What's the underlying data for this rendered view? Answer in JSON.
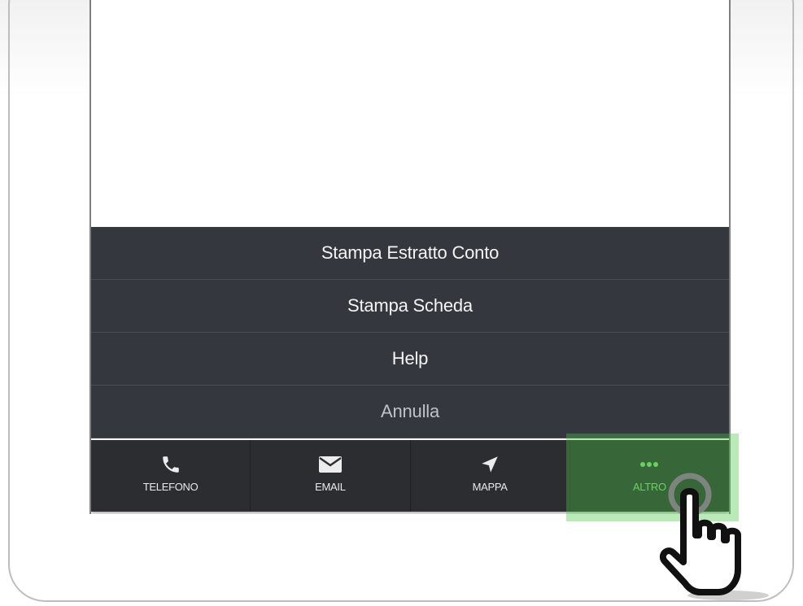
{
  "action_sheet": {
    "items": [
      {
        "label": "Stampa Estratto Conto"
      },
      {
        "label": "Stampa Scheda"
      },
      {
        "label": "Help"
      }
    ],
    "cancel_label": "Annulla"
  },
  "tabbar": {
    "tabs": [
      {
        "label": "TELEFONO",
        "icon": "phone-icon"
      },
      {
        "label": "EMAIL",
        "icon": "envelope-icon"
      },
      {
        "label": "MAPPA",
        "icon": "location-arrow-icon"
      },
      {
        "label": "ALTRO",
        "icon": "more-dots-icon"
      }
    ],
    "active_index": 3
  },
  "colors": {
    "sheet_bg": "#35373e",
    "tabbar_bg": "#2b2d31",
    "active_accent": "#7fd36d",
    "highlight": "#4cc846"
  },
  "cursor": {
    "icon": "pointer-hand-icon"
  }
}
